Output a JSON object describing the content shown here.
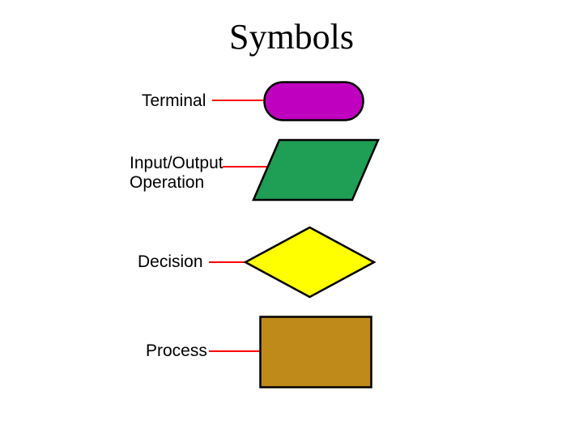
{
  "title": "Symbols",
  "rows": {
    "terminal": {
      "label": "Terminal"
    },
    "io": {
      "label": "Input/Output\nOperation"
    },
    "decision": {
      "label": "Decision"
    },
    "process": {
      "label": "Process"
    }
  },
  "colors": {
    "stroke": "#000000",
    "arrow": "#ff0000",
    "terminal_fill": "#bf00bf",
    "io_fill": "#1f9e55",
    "decision_fill": "#ffff00",
    "process_fill": "#c08a1a"
  }
}
